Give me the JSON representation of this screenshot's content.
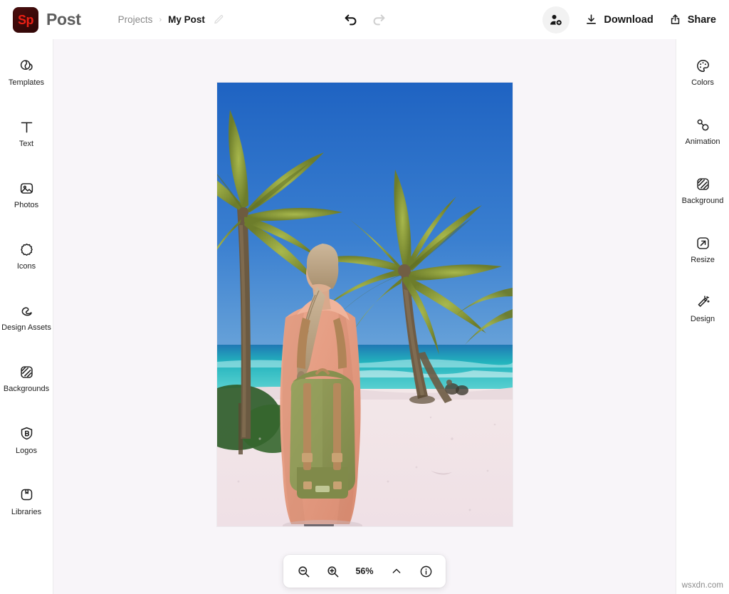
{
  "app": {
    "brand_logo_text": "Sp",
    "brand_name": "Post",
    "logo_bg_color": "#2e0606",
    "logo_fg_color": "#eb2015",
    "stage_bg_color": "#f8f5f9"
  },
  "breadcrumb": {
    "parent": "Projects",
    "separator": "›",
    "current": "My Post",
    "edit_icon": "pencil-icon"
  },
  "history": {
    "undo": {
      "label": "Undo",
      "icon": "undo-arrow-icon",
      "enabled": true
    },
    "redo": {
      "label": "Redo",
      "icon": "redo-arrow-icon",
      "enabled": false
    }
  },
  "header_actions": {
    "invite": {
      "label": "Invite",
      "icon": "add-person-icon"
    },
    "download": {
      "label": "Download",
      "icon": "download-icon"
    },
    "share": {
      "label": "Share",
      "icon": "share-icon"
    }
  },
  "left_rail": {
    "items": [
      {
        "label": "Templates",
        "icon": "templates-icon"
      },
      {
        "label": "Text",
        "icon": "text-icon"
      },
      {
        "label": "Photos",
        "icon": "photos-icon"
      },
      {
        "label": "Icons",
        "icon": "icons-icon"
      },
      {
        "label": "Design Assets",
        "icon": "design-assets-icon"
      },
      {
        "label": "Backgrounds",
        "icon": "backgrounds-icon"
      },
      {
        "label": "Logos",
        "icon": "logos-icon"
      },
      {
        "label": "Libraries",
        "icon": "libraries-icon"
      }
    ]
  },
  "right_rail": {
    "items": [
      {
        "label": "Colors",
        "icon": "palette-icon"
      },
      {
        "label": "Animation",
        "icon": "animation-icon"
      },
      {
        "label": "Background",
        "icon": "background-icon"
      },
      {
        "label": "Resize",
        "icon": "resize-icon"
      },
      {
        "label": "Design",
        "icon": "magic-wand-icon"
      }
    ]
  },
  "zoom_bar": {
    "zoom_out": {
      "label": "Zoom out",
      "icon": "zoom-out-icon"
    },
    "zoom_in": {
      "label": "Zoom in",
      "icon": "zoom-in-icon"
    },
    "value": "56%",
    "expand": {
      "label": "Zoom options",
      "icon": "chevron-up-icon"
    },
    "info": {
      "label": "Info",
      "icon": "info-icon"
    }
  },
  "canvas": {
    "description": "Woman with green backpack and peach jacket walking on a white sand beach toward turquoise ocean, framed by coconut palm trees under a deep blue sky",
    "sky_color": "#2f6fc4",
    "ocean_color": "#2fc0c4",
    "sand_color": "#f0e2e4",
    "palm_color": "#8b9b3a",
    "jacket_color": "#e8a18c",
    "backpack_color": "#8b9355"
  },
  "watermark": {
    "text": "wsxdn.com"
  }
}
